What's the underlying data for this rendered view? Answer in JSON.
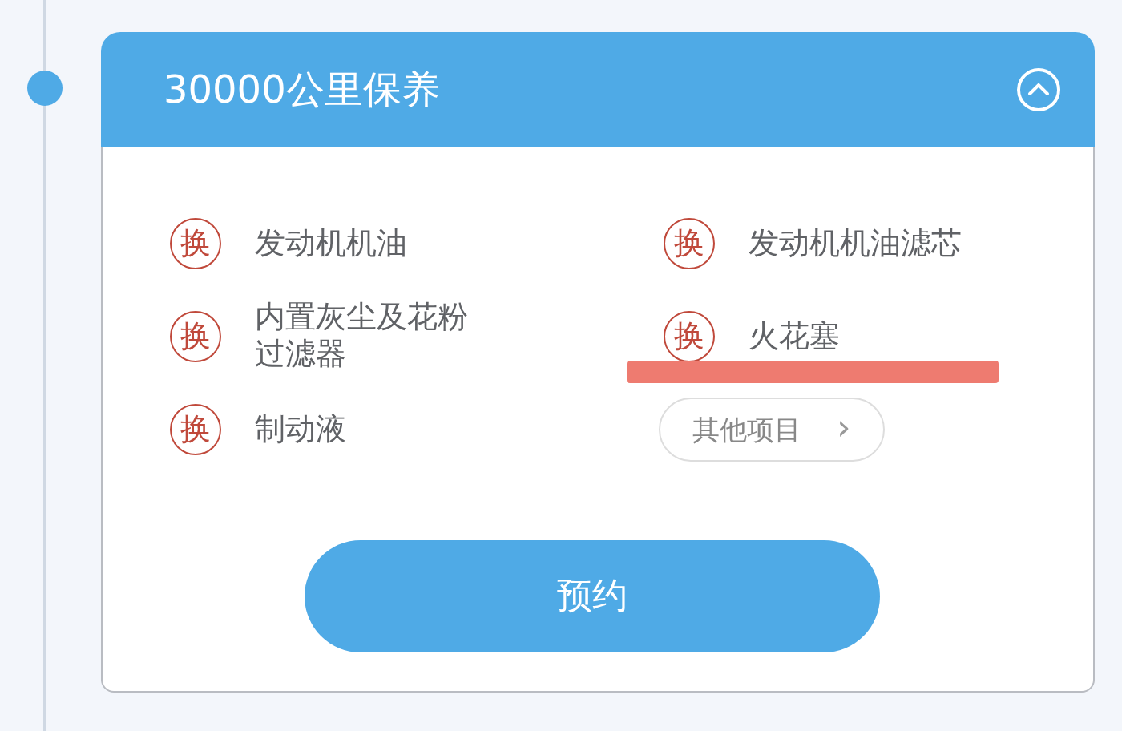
{
  "card": {
    "title": "30000公里保养",
    "expanded": true,
    "items": [
      {
        "kind": "replace",
        "badge": "换",
        "label": "发动机机油",
        "highlighted": false
      },
      {
        "kind": "replace",
        "badge": "换",
        "label": "发动机机油滤芯",
        "highlighted": false
      },
      {
        "kind": "replace",
        "badge": "换",
        "label": "内置灰尘及花粉过滤器",
        "highlighted": false
      },
      {
        "kind": "replace",
        "badge": "换",
        "label": "火花塞",
        "highlighted": true
      },
      {
        "kind": "replace",
        "badge": "换",
        "label": "制动液",
        "highlighted": false
      },
      {
        "kind": "more",
        "label": "其他项目",
        "arrow": "›"
      }
    ],
    "action": "预约"
  }
}
